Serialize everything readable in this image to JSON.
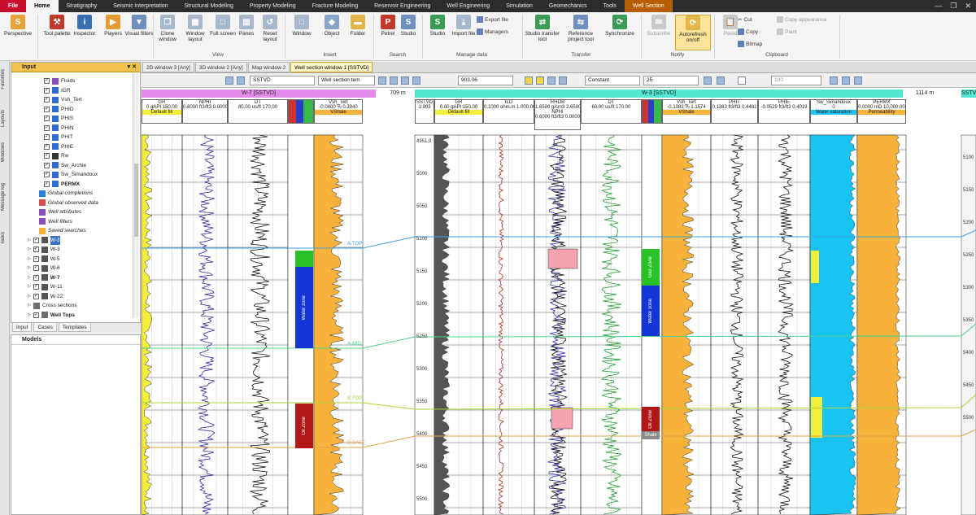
{
  "menu": {
    "file": "File",
    "tabs": [
      "Home",
      "Stratigraphy",
      "Seismic interpretation",
      "Structural Modeling",
      "Property Modeling",
      "Fracture Modeling",
      "Reservoir Engineering",
      "Well Engineering",
      "Simulation",
      "Geomechanics",
      "Tools",
      "Well Section"
    ],
    "controls": [
      "—",
      "❐",
      "✕"
    ]
  },
  "ribbon": {
    "buttons": {
      "perspective": "Perspective",
      "tool_palette": "Tool palette",
      "inspector": "Inspector",
      "players": "Players",
      "visual_filters": "Visual filters",
      "clone_window": "Clone window",
      "window_layout": "Window layout",
      "full_screen": "Full screen",
      "panes": "Panes",
      "reset_layout": "Reset layout",
      "window": "Window",
      "object": "Object",
      "folder": "Folder",
      "petrel": "Petrel",
      "studio": "Studio",
      "studio2": "Studio",
      "import_file": "Import file",
      "export_file": "Export file",
      "managers": "Managers",
      "studio_transfer": "Studio transfer tool",
      "reference_project": "Reference project tool",
      "synchronize": "Synchronize",
      "subscribe": "Subscribe",
      "autorefresh": "Autorefresh on/off",
      "paste": "Paste",
      "cut": "Cut",
      "copy": "Copy",
      "bitmap": "Bitmap",
      "copy_appearance": "Copy appearance",
      "paint": "Paint"
    },
    "groups": [
      "View",
      "Insert",
      "Search",
      "Manage data",
      "Transfer",
      "Notify",
      "Clipboard"
    ]
  },
  "sidebar": {
    "tabs": [
      "Favorites",
      "Layouts",
      "Windows",
      "Message log",
      "Tasks"
    ]
  },
  "input_panel": {
    "title": "Input",
    "items": [
      "Fluids",
      "IGR",
      "Vsh_Tert",
      "PHID",
      "PHIS",
      "PHIN",
      "PHIT",
      "PHIE",
      "Rw",
      "Sw_Archie",
      "Sw_Simandoux",
      "PERMX",
      "Global completions",
      "Global observed data",
      "Well attributes",
      "Well filters",
      "Saved searches",
      "W-3",
      "W-3",
      "W-5",
      "W-6",
      "W-7",
      "W-11",
      "W-22",
      "Cross sections",
      "Well Tops"
    ],
    "tabs": [
      "Input",
      "Cases",
      "Templates"
    ]
  },
  "models_panel": {
    "title": "Models"
  },
  "doc_tabs": [
    "2D window 3 [Any]",
    "3D window 2 [Any]",
    "Map window 2",
    "Well section window 1 [SSTVD]"
  ],
  "toolbar": {
    "domain": "SSTVD",
    "template": "Well section tem",
    "depth": "903.06",
    "scale_mode": "Constant",
    "scale": "25",
    "zoom": "100"
  },
  "wells": [
    {
      "name": "W-7 [SSTVD]",
      "distance": "709 m",
      "color": "#e28be8",
      "tracks": [
        {
          "label": "GR",
          "range": "0  gAPI  150.00",
          "fill": "Default fill",
          "fillcolor": "#f3ee3b"
        },
        {
          "label": "NPHI",
          "range": "0.6000 ft3/ft3 0.0000"
        },
        {
          "label": "DT",
          "range": "80.00  us/ft  170.00"
        },
        {
          "label": "",
          "range": ""
        },
        {
          "label": "Vsh_Tert",
          "range": "-0.0400 %  0.3940",
          "fill": "VShale",
          "fillcolor": "#f6b23b"
        }
      ]
    },
    {
      "name": "W-3 [SSTVD]",
      "distance": "1114 m",
      "color": "#52e8d2",
      "tracks": [
        {
          "label": "SSTVD",
          "range": "1:903"
        },
        {
          "label": "GR",
          "range": "0.00  gAPI  150.00",
          "fill": "Default fill",
          "fillcolor": "#f3ee3b"
        },
        {
          "label": "ILD",
          "range": "0.1000 ohm.m 1.000.0000"
        },
        {
          "label": "RHOB",
          "range": "1.6500 g/cm3 2.6500",
          "sub": "NPHI",
          "subrange": "0.6000 ft3/ft3 0.0000"
        },
        {
          "label": "DT",
          "range": "60.00  us/ft  170.00"
        },
        {
          "label": "",
          "range": ""
        },
        {
          "label": "Vsh_Tert",
          "range": "-0.1082  %  1.1574",
          "fill": "VShale",
          "fillcolor": "#f6b23b"
        },
        {
          "label": "PHIT",
          "range": "0.1383 ft3/ft3 0.4481"
        },
        {
          "label": "PHIE",
          "range": "-0.0529 ft3/ft3 0.4019"
        },
        {
          "label": "Sw_Simandoux",
          "range": "0",
          "fill": "Water saturation",
          "fillcolor": "#19c4f2"
        },
        {
          "label": "PERMX",
          "range": "0.0000 mD 10,000.0000",
          "fill": "Permeability",
          "fillcolor": "#f6b23b"
        }
      ]
    },
    {
      "name": "SSTVD",
      "distance": "",
      "color": "#52e8d2",
      "tracks": []
    }
  ],
  "depth_ticks": [
    "4951.9",
    "5000",
    "5050",
    "5100",
    "5150",
    "5200",
    "5250",
    "5300",
    "5350",
    "5400",
    "5450",
    "5500"
  ],
  "right_ticks": [
    "5100",
    "5150",
    "5200",
    "5250",
    "5300",
    "5350",
    "5400",
    "5450",
    "5500"
  ],
  "zones_w7": [
    "Water zone",
    "Oil Zone"
  ],
  "zones_w3": [
    "Gas Zone",
    "Water zone",
    "Oil Zone",
    "Shale"
  ],
  "tops": [
    "A-TOP",
    "A-MID",
    "B-TOP",
    "B-BASE"
  ],
  "colors": {
    "accent": "#d1a730",
    "file": "#c8102e",
    "well_w7": "#e28be8",
    "well_w3": "#52e8d2",
    "gr_fill": "#f3ee3b",
    "vsh_fill": "#f6b23b",
    "sw_fill": "#19c4f2",
    "gas": "#28c228",
    "water": "#1434d6",
    "oil": "#b01818",
    "rhob_fill": "#f5a3b0"
  }
}
